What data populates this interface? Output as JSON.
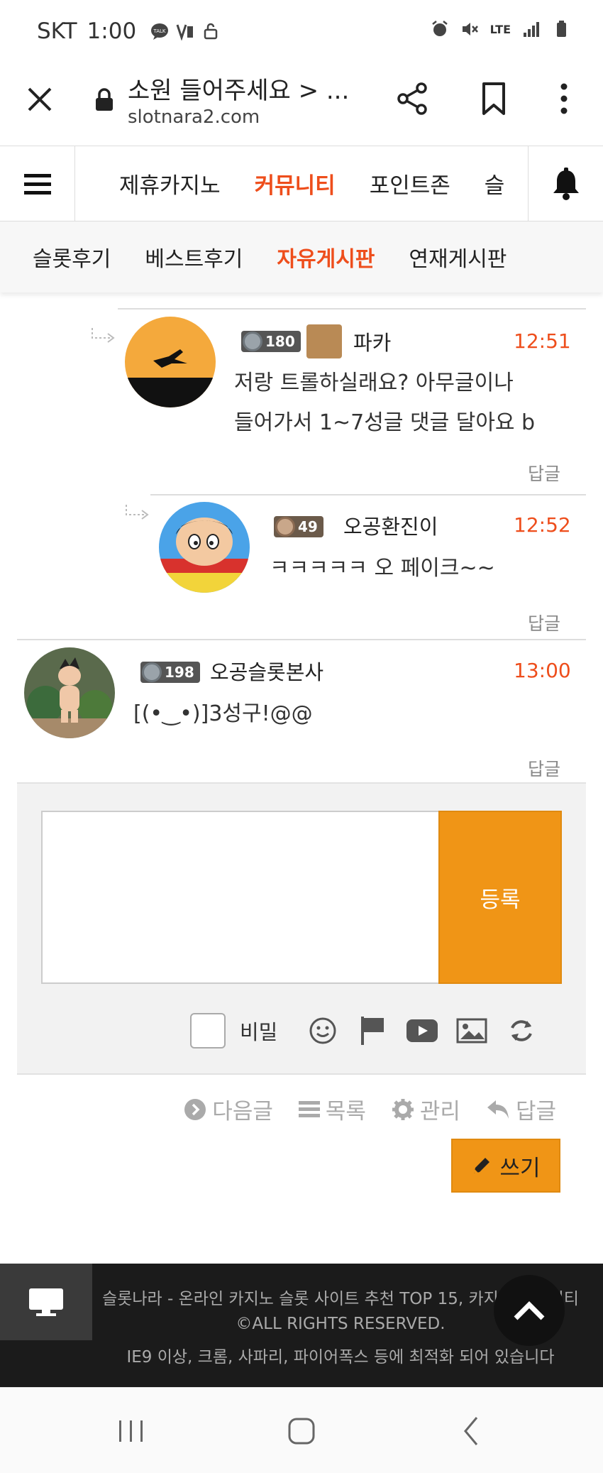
{
  "status_bar": {
    "carrier": "SKT",
    "time": "1:00",
    "network": "LTE"
  },
  "browser": {
    "title": "소원 들어주세요 > ...",
    "url": "slotnara2.com"
  },
  "main_nav": {
    "items": [
      "제휴카지노",
      "커뮤니티",
      "포인트존",
      "슬"
    ],
    "active_index": 1
  },
  "sub_nav": {
    "items": [
      "슬롯후기",
      "베스트후기",
      "자유게시판",
      "연재게시판"
    ],
    "active_index": 2
  },
  "comments": [
    {
      "level": "180",
      "nickname": "파카",
      "time": "12:51",
      "lines": [
        "저랑 트롤하실래요? 아무글이나",
        "들어가서 1~7성글 댓글 달아요 b"
      ],
      "reply_label": "답글"
    },
    {
      "level": "49",
      "nickname": "오공환진이",
      "time": "12:52",
      "lines": [
        "ㅋㅋㅋㅋㅋ 오 페이크~~"
      ],
      "reply_label": "답글"
    },
    {
      "level": "198",
      "nickname": "오공슬롯본사",
      "time": "13:00",
      "lines": [
        "[(•‿•)]3성구!@@"
      ],
      "reply_label": "답글"
    }
  ],
  "comment_form": {
    "submit_label": "등록",
    "secret_label": "비밀"
  },
  "bottom_links": {
    "next": "다음글",
    "list": "목록",
    "manage": "관리",
    "reply": "답글",
    "write": "쓰기"
  },
  "footer": {
    "line1": "슬롯나라 - 온라인 카지노 슬롯 사이트 추천 TOP 15, 카지노 커뮤니티",
    "line2": "©ALL RIGHTS RESERVED.",
    "line3": "IE9 이상, 크롬, 사파리, 파이어폭스 등에 최적화 되어 있습니다"
  },
  "colors": {
    "accent": "#ee4e1c",
    "button": "#f09516",
    "footer_bg": "#1b1b1b"
  }
}
